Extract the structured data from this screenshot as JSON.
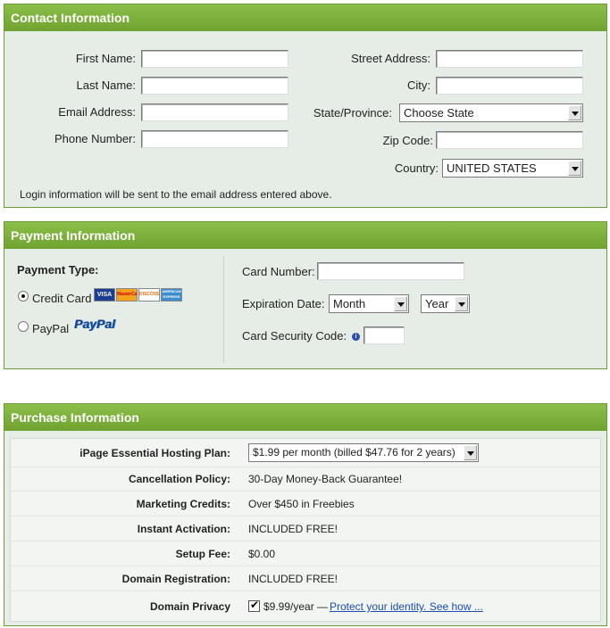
{
  "contact": {
    "header": "Contact Information",
    "first_name_label": "First Name:",
    "last_name_label": "Last Name:",
    "email_label": "Email Address:",
    "phone_label": "Phone Number:",
    "street_label": "Street Address:",
    "city_label": "City:",
    "state_label": "State/Province:",
    "state_value": "Choose State",
    "zip_label": "Zip Code:",
    "country_label": "Country:",
    "country_value": "UNITED STATES",
    "note": "Login information will be sent to the email address entered above."
  },
  "payment": {
    "header": "Payment Information",
    "type_label": "Payment Type:",
    "credit_card_label": "Credit Card",
    "paypal_label": "PayPal",
    "paypal_logo_text": "PayPal",
    "selected_type": "Credit Card",
    "card_logos": [
      "VISA",
      "MasterCard",
      "DISCOVER",
      "AMERICAN EXPRESS"
    ],
    "card_number_label": "Card Number:",
    "expiration_label": "Expiration Date:",
    "month_value": "Month",
    "year_value": "Year",
    "security_label": "Card Security Code:",
    "info_icon_glyph": "i"
  },
  "purchase": {
    "header": "Purchase Information",
    "plan_label": "iPage Essential Hosting Plan:",
    "plan_value": "$1.99 per month (billed $47.76 for 2 years)",
    "rows": [
      {
        "label": "Cancellation Policy:",
        "value": "30-Day Money-Back Guarantee!"
      },
      {
        "label": "Marketing Credits:",
        "value": "Over $450 in Freebies"
      },
      {
        "label": "Instant Activation:",
        "value": "INCLUDED FREE!"
      },
      {
        "label": "Setup Fee:",
        "value": "$0.00"
      },
      {
        "label": "Domain Registration:",
        "value": "INCLUDED FREE!"
      }
    ],
    "privacy_label": "Domain Privacy",
    "privacy_checked": true,
    "privacy_price": "$9.99/year —",
    "privacy_link": "Protect your identity. See how ..."
  },
  "colors": {
    "header_green": "#7aae3a",
    "panel_bg": "#e6ede6",
    "link_blue": "#1a4fb0"
  }
}
